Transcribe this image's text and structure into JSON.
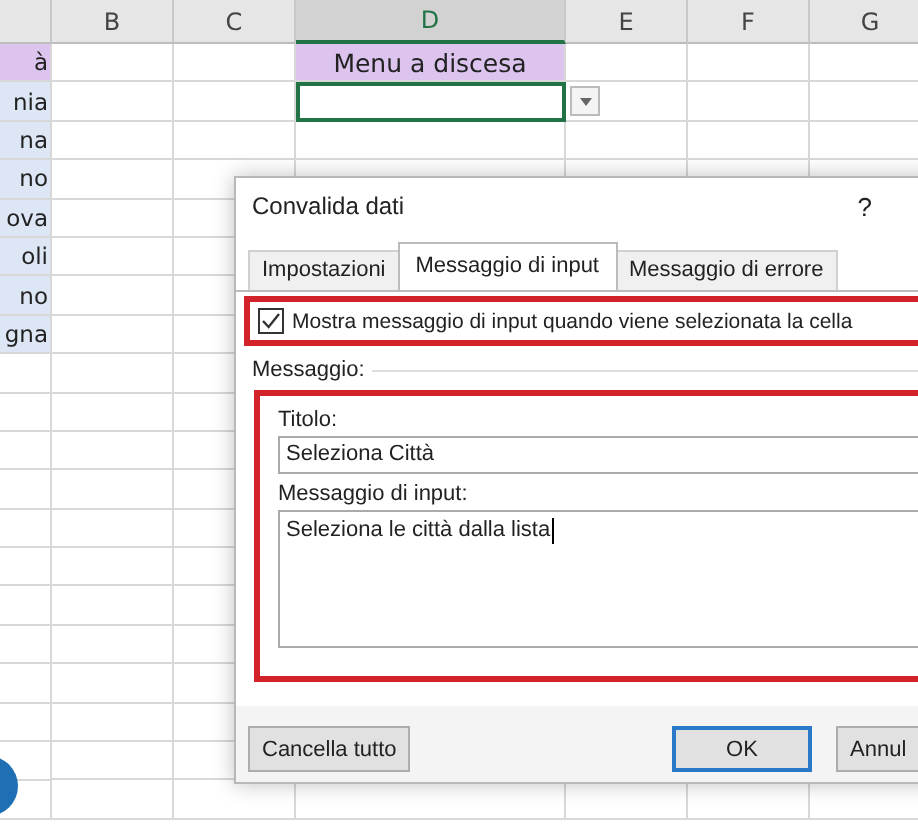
{
  "sheet": {
    "columns": [
      "B",
      "C",
      "D",
      "E",
      "F",
      "G"
    ],
    "list_column": {
      "header": "à",
      "items": [
        "nia",
        "na",
        "no",
        "ova",
        "oli",
        "no",
        "gna"
      ]
    },
    "d_header": "Menu a discesa",
    "active_cell": {
      "dropdown": true
    }
  },
  "dialog": {
    "title": "Convalida dati",
    "help": "?",
    "tabs": [
      {
        "label": "Impostazioni",
        "selected": false
      },
      {
        "label": "Messaggio di input",
        "selected": true
      },
      {
        "label": "Messaggio di errore",
        "selected": false
      }
    ],
    "show_message": {
      "label": "Mostra messaggio di input quando viene selezionata la cella",
      "checked": true,
      "highlighted": true
    },
    "group": {
      "label": "Messaggio:",
      "highlighted": true
    },
    "title_field": {
      "label": "Titolo:",
      "value": "Seleziona Città"
    },
    "message_field": {
      "label": "Messaggio di input:",
      "value": "Seleziona le città dalla lista"
    },
    "buttons": [
      {
        "label": "Cancella tutto",
        "kind": "secondary"
      },
      {
        "label": "OK",
        "kind": "default"
      },
      {
        "label": "Annul",
        "kind": "secondary"
      }
    ]
  }
}
